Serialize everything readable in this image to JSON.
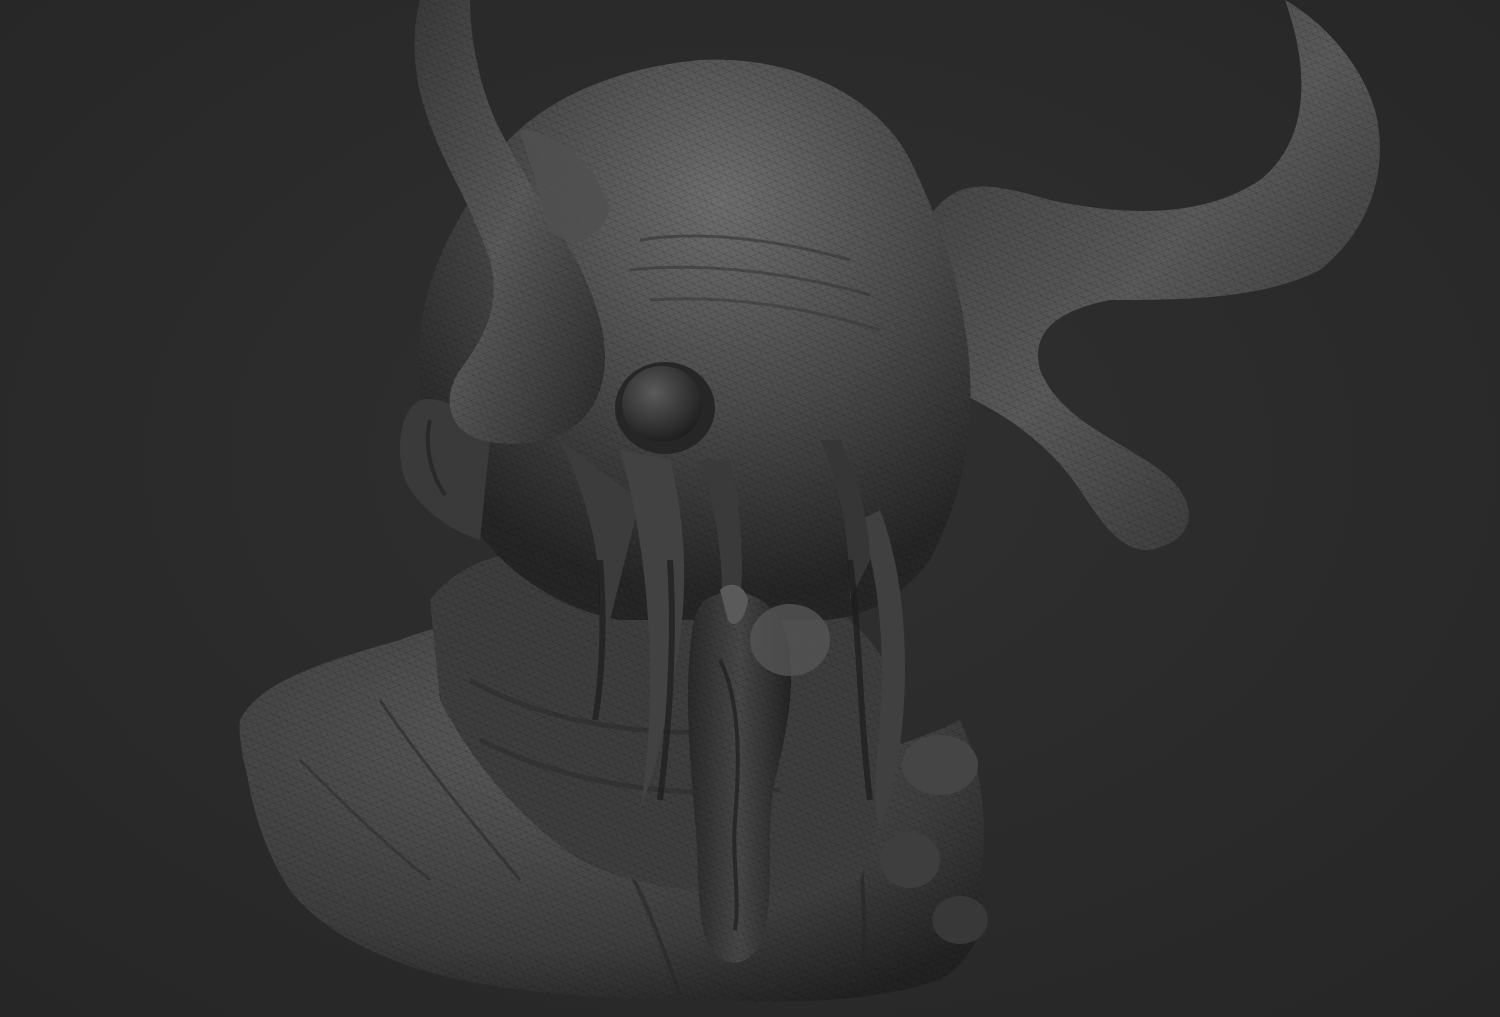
{
  "viewport": {
    "background_color": "#2b2b2b",
    "model_base_color": "#4a4a4a",
    "model_shadow_color": "#1e1e1e",
    "model_highlight_color": "#7a7a7a",
    "render_style": "wireframe-on-shaded"
  },
  "model": {
    "subject": "demon-bust",
    "parts": [
      "horn-left",
      "horn-right",
      "cranium",
      "eye-socket",
      "facial-tendrils",
      "tongue",
      "neck",
      "shoulders"
    ]
  }
}
